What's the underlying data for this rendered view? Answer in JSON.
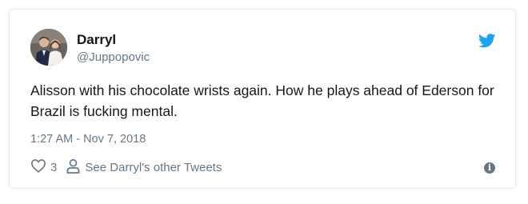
{
  "tweet": {
    "author_name": "Darryl",
    "author_handle": "@Juppopovic",
    "text": "Alisson with his chocolate wrists again. How he plays ahead of Ederson for Brazil is fucking mental.",
    "timestamp": "1:27 AM - Nov 7, 2018",
    "like_count": "3",
    "other_tweets_label": "See Darryl's other Tweets"
  },
  "icons": {
    "brand": "twitter-bird-icon",
    "like": "heart-icon",
    "profile": "person-icon",
    "info": "info-icon"
  },
  "colors": {
    "twitter_blue": "#1da1f2",
    "text_primary": "#14171a",
    "text_secondary": "#657786",
    "border": "#e1e8ed"
  }
}
